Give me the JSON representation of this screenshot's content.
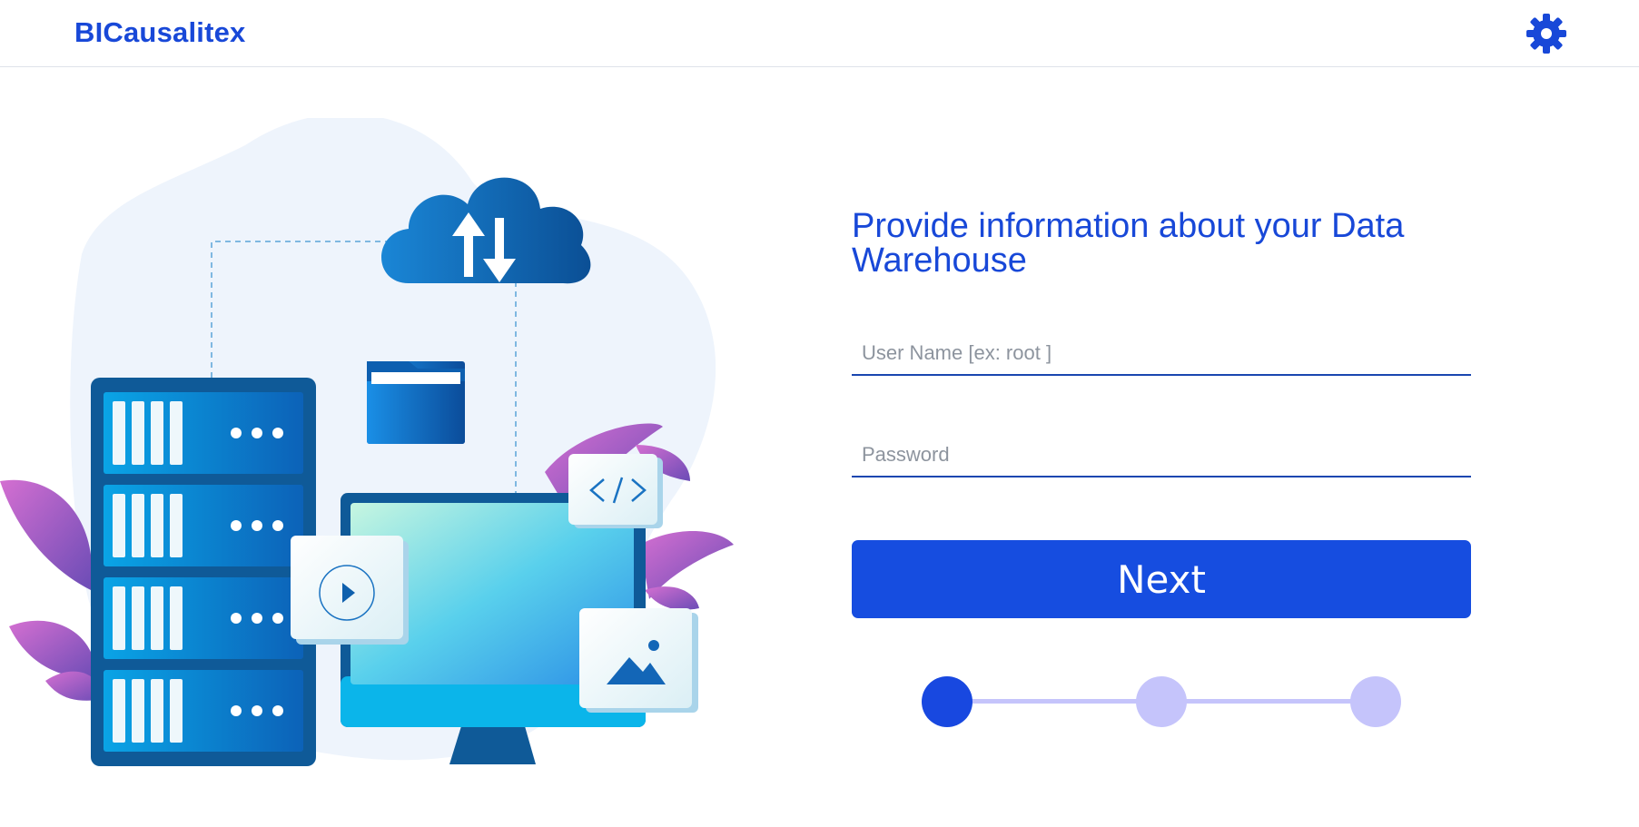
{
  "app": {
    "brand": "BICausalitex"
  },
  "header": {
    "settings_icon": "gear-icon"
  },
  "form": {
    "title": "Provide information about your Data Warehouse",
    "username_placeholder": "User Name [ex: root ]",
    "username_value": "",
    "password_placeholder": "Password",
    "password_value": "",
    "next_label": "Next"
  },
  "stepper": {
    "total_steps": 3,
    "current_step": 1
  },
  "colors": {
    "accent": "#1848d8",
    "button": "#164de0",
    "step_active": "#1848e0",
    "step_inactive": "#c5c4fb"
  },
  "illustration": {
    "icons": [
      "cloud-sync-icon",
      "folder-icon",
      "server-rack-icon",
      "monitor-icon",
      "play-icon",
      "code-icon",
      "image-icon"
    ]
  }
}
